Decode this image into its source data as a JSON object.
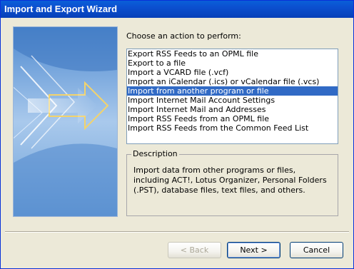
{
  "window": {
    "title": "Import and Export Wizard"
  },
  "prompt": {
    "label": "Choose an action to perform:"
  },
  "actions": [
    {
      "label": "Export RSS Feeds to an OPML file",
      "selected": false
    },
    {
      "label": "Export to a file",
      "selected": false
    },
    {
      "label": "Import a VCARD file (.vcf)",
      "selected": false
    },
    {
      "label": "Import an iCalendar (.ics) or vCalendar file (.vcs)",
      "selected": false
    },
    {
      "label": "Import from another program or file",
      "selected": true
    },
    {
      "label": "Import Internet Mail Account Settings",
      "selected": false
    },
    {
      "label": "Import Internet Mail and Addresses",
      "selected": false
    },
    {
      "label": "Import RSS Feeds from an OPML file",
      "selected": false
    },
    {
      "label": "Import RSS Feeds from the Common Feed List",
      "selected": false
    }
  ],
  "description": {
    "legend": "Description",
    "text": "Import data from other programs or files, including ACT!, Lotus Organizer, Personal Folders (.PST), database files, text files, and others."
  },
  "buttons": {
    "back": "< Back",
    "next": "Next >",
    "cancel": "Cancel"
  },
  "colors": {
    "titlebar": "#0b4fcf",
    "selection": "#316ac5",
    "dialog_bg": "#ece9d8"
  },
  "icons": {
    "wizard_art": "arrow-art-icon"
  }
}
